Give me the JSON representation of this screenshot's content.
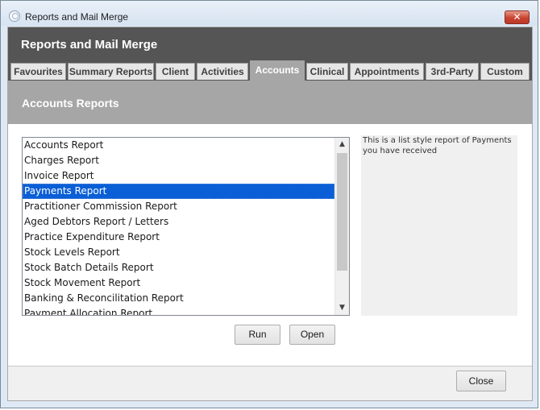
{
  "window": {
    "title": "Reports and Mail Merge",
    "close_glyph": "✕"
  },
  "header": {
    "title": "Reports and Mail Merge"
  },
  "tabs": [
    {
      "label": "Favourites"
    },
    {
      "label": "Summary Reports"
    },
    {
      "label": "Client"
    },
    {
      "label": "Activities"
    },
    {
      "label": "Accounts"
    },
    {
      "label": "Clinical"
    },
    {
      "label": "Appointments"
    },
    {
      "label": "3rd-Party"
    },
    {
      "label": "Custom"
    }
  ],
  "active_tab": "Accounts",
  "section": {
    "title": "Accounts Reports"
  },
  "reports": [
    "Accounts Report",
    "Charges Report",
    "Invoice Report",
    "Payments Report",
    "Practitioner Commission Report",
    "Aged Debtors Report / Letters",
    "Practice Expenditure Report",
    "Stock Levels Report",
    "Stock Batch Details Report",
    "Stock Movement Report",
    "Banking & Reconcilitation Report",
    "Payment Allocation Report"
  ],
  "selected_report": "Payments Report",
  "description": "This is a list style report of Payments you have received",
  "buttons": {
    "run": "Run",
    "open": "Open",
    "close": "Close"
  },
  "icons": {
    "app": "app-logo-icon",
    "scroll_up": "chevron-up-icon",
    "scroll_down": "chevron-down-icon"
  },
  "colors": {
    "header": "#555555",
    "section": "#a6a6a6",
    "selection": "#0a5fd6",
    "close": "#c9432f"
  }
}
